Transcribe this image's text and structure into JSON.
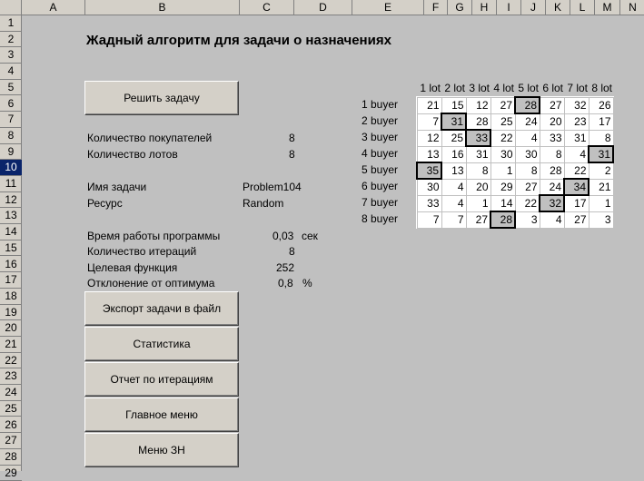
{
  "columns": [
    "A",
    "B",
    "C",
    "D",
    "E",
    "F",
    "G",
    "H",
    "I",
    "J",
    "K",
    "L",
    "M",
    "N"
  ],
  "rows": [
    "1",
    "2",
    "3",
    "4",
    "5",
    "6",
    "7",
    "8",
    "9",
    "10",
    "11",
    "12",
    "13",
    "14",
    "15",
    "16",
    "17",
    "18",
    "19",
    "20",
    "21",
    "22",
    "23",
    "24",
    "25",
    "26",
    "27",
    "28",
    "29"
  ],
  "title": "Жадный алгоритм для задачи о назначениях",
  "solve_button": "Решить задачу",
  "info": {
    "buyers_label": "Количество покупателей",
    "buyers_value": "8",
    "lots_label": "Количество лотов",
    "lots_value": "8",
    "task_label": "Имя задачи",
    "task_value": "Problem104",
    "resource_label": "Ресурс",
    "resource_value": "Random",
    "runtime_label": "Время работы программы",
    "runtime_value": "0,03",
    "runtime_unit": "сек",
    "iter_label": "Количество итераций",
    "iter_value": "8",
    "objective_label": "Целевая функция",
    "objective_value": "252",
    "deviation_label": "Отклонение от оптимума",
    "deviation_value": "0,8",
    "deviation_unit": "%"
  },
  "buttons": [
    "Экспорт задачи в файл",
    "Статистика",
    "Отчет по итерациям",
    "Главное меню",
    "Меню ЗН"
  ],
  "lots": [
    "1 lot",
    "2 lot",
    "3 lot",
    "4 lot",
    "5 lot",
    "6 lot",
    "7 lot",
    "8 lot"
  ],
  "buyers": [
    "1 buyer",
    "2 buyer",
    "3 buyer",
    "4 buyer",
    "5 buyer",
    "6 buyer",
    "7 buyer",
    "8 buyer"
  ],
  "matrix": [
    [
      21,
      15,
      12,
      27,
      28,
      27,
      32,
      26
    ],
    [
      7,
      31,
      28,
      25,
      24,
      20,
      23,
      17
    ],
    [
      12,
      25,
      33,
      22,
      4,
      33,
      31,
      8
    ],
    [
      13,
      16,
      31,
      30,
      30,
      8,
      4,
      31
    ],
    [
      35,
      13,
      8,
      1,
      8,
      28,
      22,
      2
    ],
    [
      30,
      4,
      20,
      29,
      27,
      24,
      34,
      21
    ],
    [
      33,
      4,
      1,
      14,
      22,
      32,
      17,
      1
    ],
    [
      7,
      7,
      27,
      28,
      3,
      4,
      27,
      3
    ]
  ],
  "assigned": [
    4,
    1,
    2,
    7,
    0,
    6,
    5,
    3
  ],
  "highlight_color": "#c0c0c0"
}
